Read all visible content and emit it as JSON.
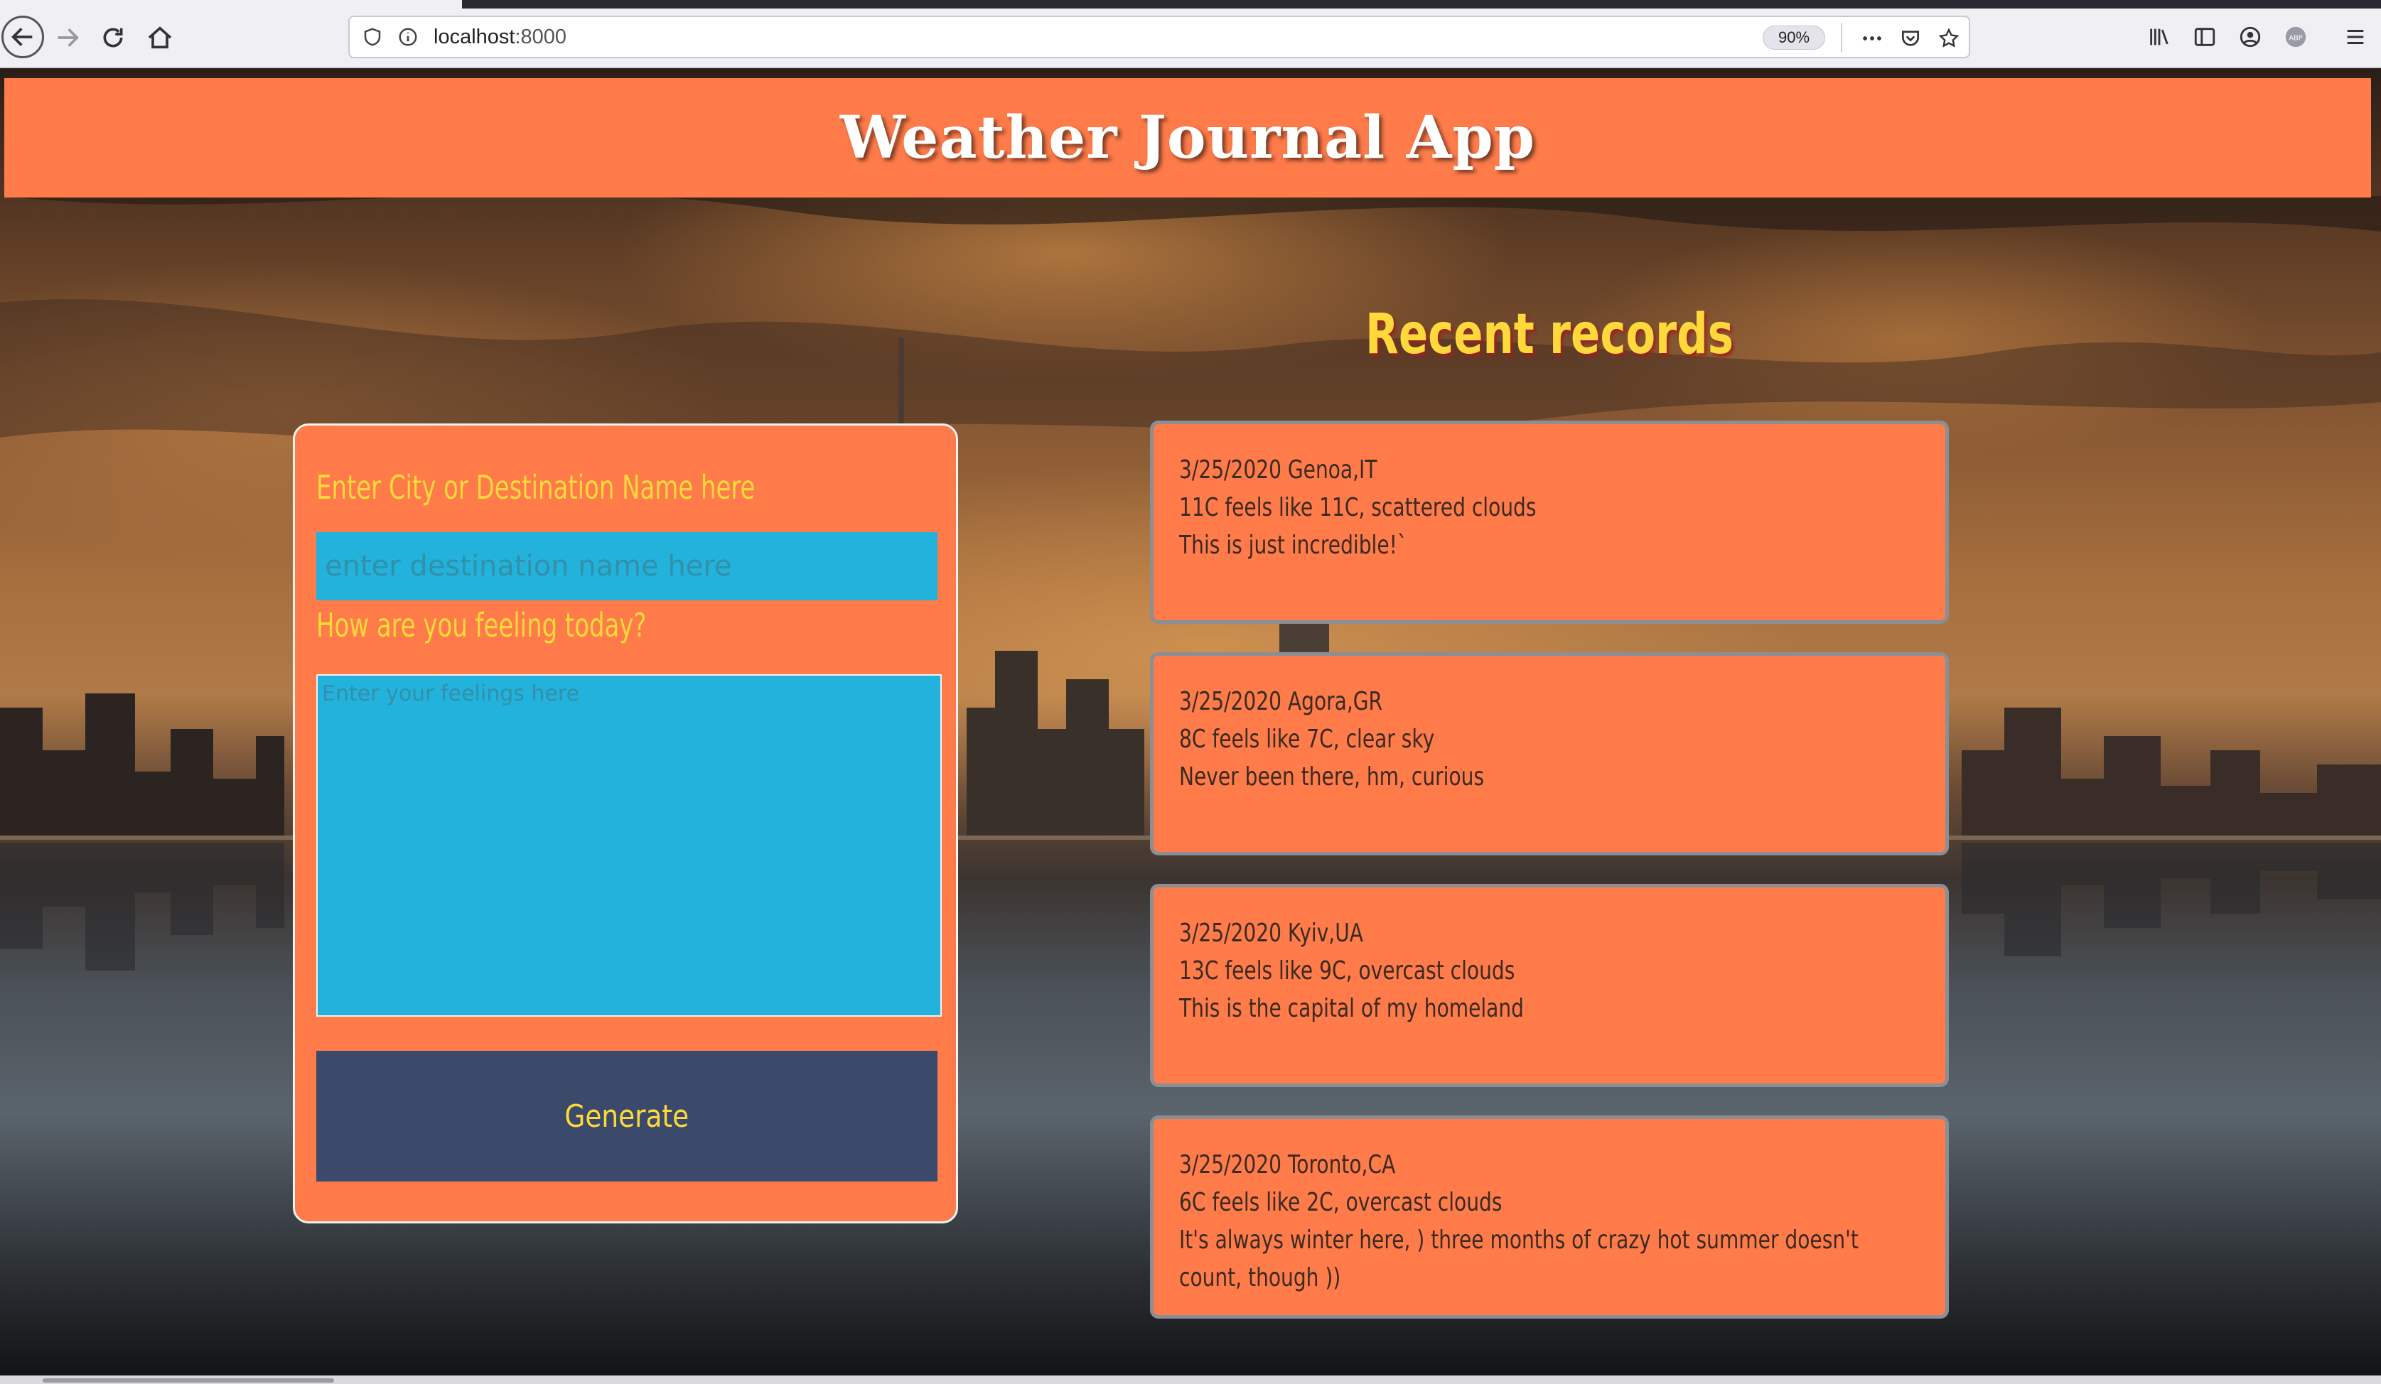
{
  "browser": {
    "url_host": "localhost",
    "url_port": ":8000",
    "zoom": "90%",
    "icons": [
      "back-icon",
      "forward-icon",
      "reload-icon",
      "home-icon",
      "shield-icon",
      "info-icon",
      "more-icon",
      "pocket-icon",
      "bookmark-star-icon",
      "library-icon",
      "sidebar-icon",
      "account-icon",
      "adblock-icon",
      "menu-icon"
    ]
  },
  "header": {
    "title": "Weather Journal App"
  },
  "form": {
    "city_label": "Enter City or Destination Name here",
    "city_placeholder": "enter destination name here",
    "feelings_label": "How are you feeling today?",
    "feelings_placeholder": "Enter your feelings here",
    "generate_label": "Generate"
  },
  "records": {
    "title": "Recent records",
    "items": [
      {
        "line1": "3/25/2020 Genoa,IT",
        "line2": "11C feels like 11C, scattered clouds",
        "line3": "This is just incredible!`"
      },
      {
        "line1": "3/25/2020 Agora,GR",
        "line2": "8C feels like 7C, clear sky",
        "line3": "Never been there, hm, curious"
      },
      {
        "line1": "3/25/2020 Kyiv,UA",
        "line2": "13C feels like 9C, overcast clouds",
        "line3": "This is the capital of my homeland"
      },
      {
        "line1": "3/25/2020 Toronto,CA",
        "line2": "6C feels like 2C, overcast clouds",
        "line3": "It's always winter here, ) three months of crazy hot summer doesn't count, though ))"
      }
    ]
  },
  "colors": {
    "accent_orange": "#ff7b4a",
    "label_yellow": "#ffd93b",
    "input_blue": "#22b2db",
    "button_navy": "#3b4a6b"
  }
}
